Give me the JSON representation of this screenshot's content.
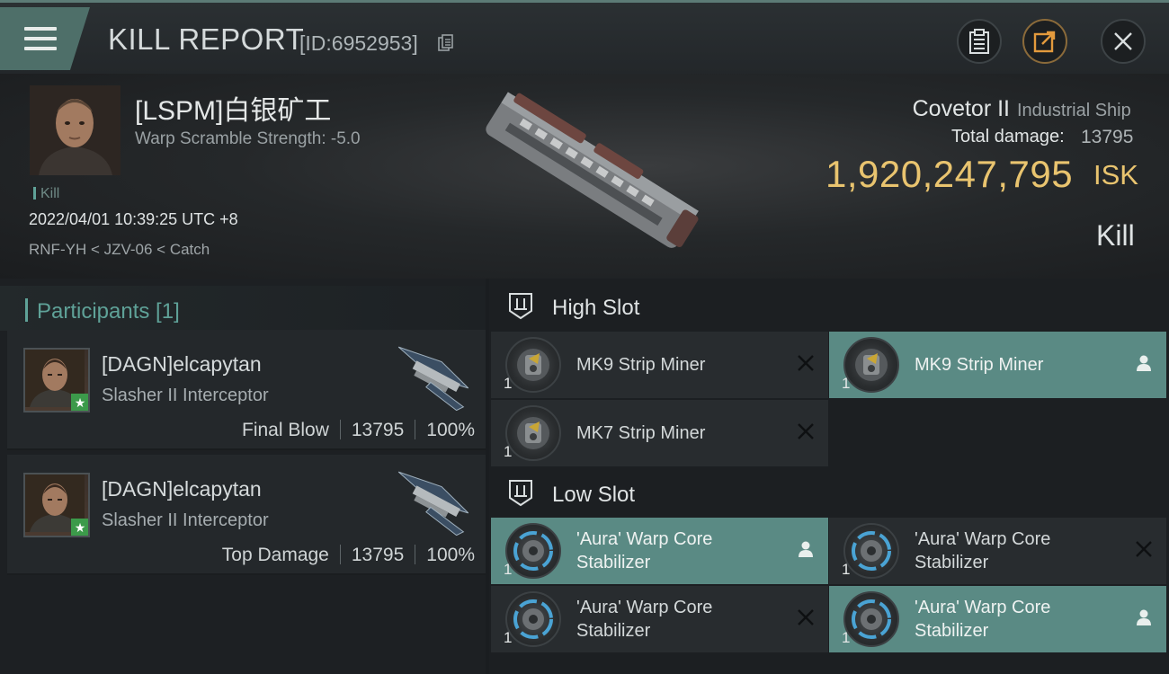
{
  "header": {
    "title": "KILL REPORT",
    "kill_id": "[ID:6952953]"
  },
  "victim": {
    "name": "[LSPM]白银矿工",
    "warp_strength": "Warp Scramble Strength: -5.0",
    "tag": "Kill",
    "time": "2022/04/01 10:39:25 UTC +8",
    "location": "RNF-YH < JZV-06 < Catch"
  },
  "ship": {
    "name": "Covetor II",
    "class": "Industrial Ship",
    "damage_label": "Total damage:",
    "damage_value": "13795",
    "isk_value": "1,920,247,795",
    "isk_unit": "ISK",
    "result": "Kill"
  },
  "participants": {
    "title": "Participants [1]",
    "items": [
      {
        "name": "[DAGN]elcapytan",
        "ship": "Slasher II Interceptor",
        "role": "Final Blow",
        "damage": "13795",
        "percent": "100%"
      },
      {
        "name": "[DAGN]elcapytan",
        "ship": "Slasher II Interceptor",
        "role": "Top Damage",
        "damage": "13795",
        "percent": "100%"
      }
    ]
  },
  "fitting": {
    "high_slot": {
      "title": "High Slot",
      "modules": [
        {
          "name": "MK9 Strip Miner",
          "qty": "1",
          "status": "destroyed"
        },
        {
          "name": "MK9 Strip Miner",
          "qty": "1",
          "status": "dropped"
        },
        {
          "name": "MK7 Strip Miner",
          "qty": "1",
          "status": "destroyed"
        }
      ]
    },
    "low_slot": {
      "title": "Low Slot",
      "modules": [
        {
          "name": "'Aura' Warp Core Stabilizer",
          "qty": "1",
          "status": "dropped"
        },
        {
          "name": "'Aura' Warp Core Stabilizer",
          "qty": "1",
          "status": "destroyed"
        },
        {
          "name": "'Aura' Warp Core Stabilizer",
          "qty": "1",
          "status": "destroyed"
        },
        {
          "name": "'Aura' Warp Core Stabilizer",
          "qty": "1",
          "status": "dropped"
        }
      ]
    }
  },
  "colors": {
    "accent": "#5fa298",
    "isk": "#e9c46f",
    "fitted_bg": "#5a8a84"
  }
}
